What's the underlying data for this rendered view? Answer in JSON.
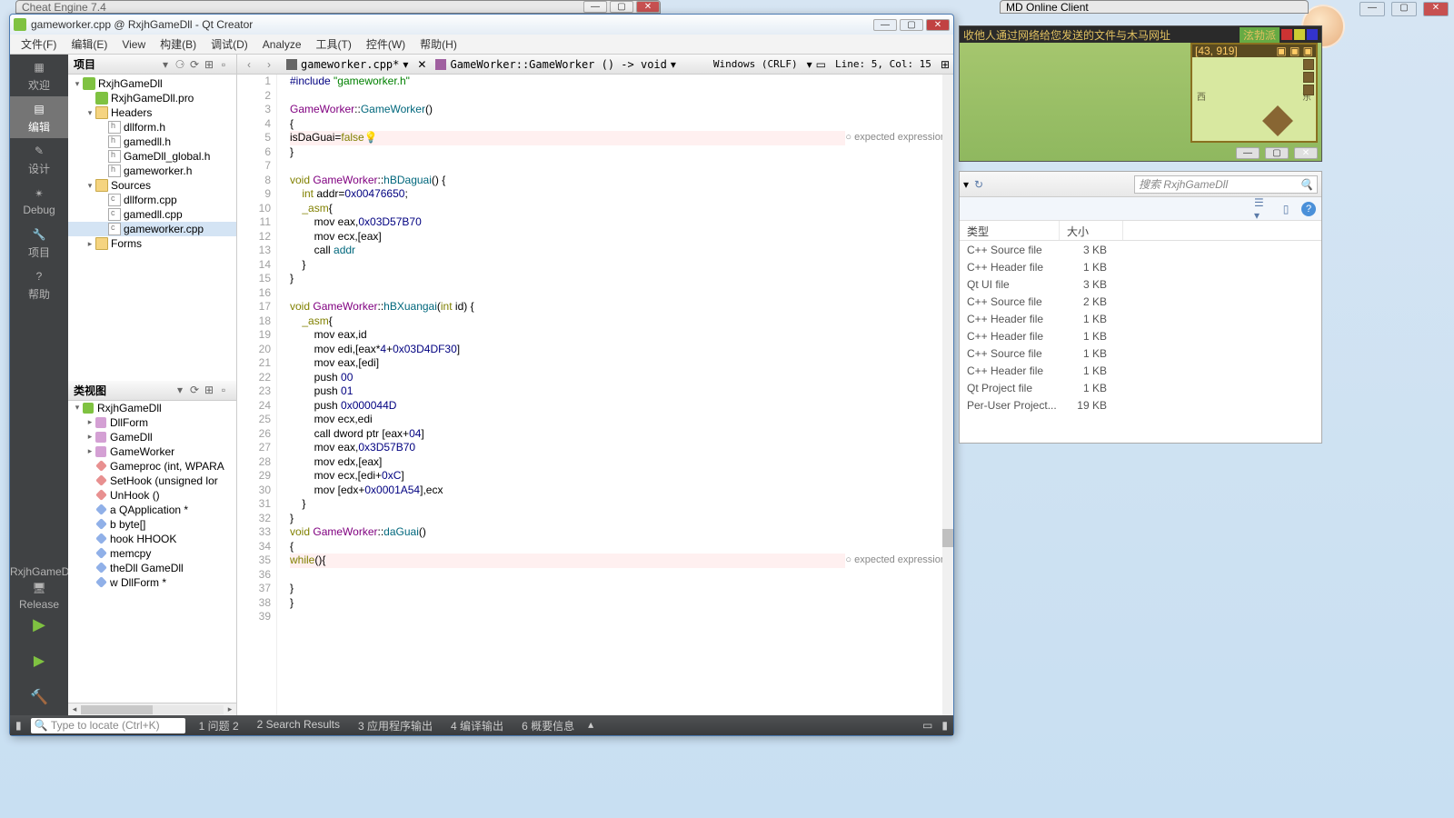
{
  "cheat_engine": {
    "title": "Cheat Engine 7.4"
  },
  "game_client": {
    "title": "MD Online Client"
  },
  "qtc": {
    "title": "gameworker.cpp @ RxjhGameDll - Qt Creator",
    "menu": [
      "文件(F)",
      "编辑(E)",
      "View",
      "构建(B)",
      "调试(D)",
      "Analyze",
      "工具(T)",
      "控件(W)",
      "帮助(H)"
    ],
    "sidebar": {
      "items": [
        "欢迎",
        "编辑",
        "设计",
        "Debug",
        "项目",
        "帮助"
      ],
      "kit_name": "RxjhGameDll",
      "kit_build": "Release"
    },
    "project_panel_title": "项目",
    "class_panel_title": "类视图",
    "tree": {
      "root": "RxjhGameDll",
      "pro": "RxjhGameDll.pro",
      "headers_label": "Headers",
      "headers": [
        "dllform.h",
        "gamedll.h",
        "GameDll_global.h",
        "gameworker.h"
      ],
      "sources_label": "Sources",
      "sources": [
        "dllform.cpp",
        "gamedll.cpp",
        "gameworker.cpp"
      ],
      "forms_label": "Forms"
    },
    "classes": {
      "root": "RxjhGameDll",
      "items": [
        "DllForm",
        "GameDll",
        "GameWorker",
        "Gameproc (int, WPARA",
        "SetHook (unsigned lor",
        "UnHook ()",
        "a QApplication *",
        "b byte[]",
        "hook HHOOK",
        "memcpy",
        "theDll GameDll",
        "w DllForm *"
      ]
    },
    "editor": {
      "file_crumb": "gameworker.cpp*",
      "symbol_crumb": "GameWorker::GameWorker () -> void",
      "encoding": "Windows (CRLF)",
      "position": "Line: 5, Col: 15",
      "error_text": "expected expression",
      "lines": [
        {
          "n": 1,
          "html": "<span class='pp'>#include</span> <span class='str'>\"gameworker.h\"</span>"
        },
        {
          "n": 2,
          "html": ""
        },
        {
          "n": 3,
          "html": "<span class='type'>GameWorker</span>::<span class='func'>GameWorker</span>()"
        },
        {
          "n": 4,
          "html": "{"
        },
        {
          "n": 5,
          "err": true,
          "html": "isDaGuai=<span class='kw'>false</span><span class='bulb'>💡</span>"
        },
        {
          "n": 6,
          "html": "}"
        },
        {
          "n": 7,
          "html": ""
        },
        {
          "n": 8,
          "html": "<span class='kw'>void</span> <span class='type'>GameWorker</span>::<span class='func'>hBDaguai</span>() {"
        },
        {
          "n": 9,
          "html": "    <span class='kw'>int</span> addr=<span class='num'>0x00476650</span>;"
        },
        {
          "n": 10,
          "html": "    <span class='kw'>_asm</span>{"
        },
        {
          "n": 11,
          "html": "        mov eax,<span class='num'>0x03D57B70</span>"
        },
        {
          "n": 12,
          "html": "        mov ecx,[eax]"
        },
        {
          "n": 13,
          "html": "        call <span class='func'>addr</span>"
        },
        {
          "n": 14,
          "html": "    }"
        },
        {
          "n": 15,
          "html": "}"
        },
        {
          "n": 16,
          "html": ""
        },
        {
          "n": 17,
          "html": "<span class='kw'>void</span> <span class='type'>GameWorker</span>::<span class='func'>hBXuangai</span>(<span class='kw'>int</span> id) {"
        },
        {
          "n": 18,
          "html": "    <span class='kw'>_asm</span>{"
        },
        {
          "n": 19,
          "html": "        mov eax,id"
        },
        {
          "n": 20,
          "html": "        mov edi,[eax*<span class='num'>4</span>+<span class='num'>0x03D4DF30</span>]"
        },
        {
          "n": 21,
          "html": "        mov eax,[edi]"
        },
        {
          "n": 22,
          "html": "        push <span class='num'>00</span>"
        },
        {
          "n": 23,
          "html": "        push <span class='num'>01</span>"
        },
        {
          "n": 24,
          "html": "        push <span class='num'>0x000044D</span>"
        },
        {
          "n": 25,
          "html": "        mov ecx,edi"
        },
        {
          "n": 26,
          "html": "        call dword ptr [eax+<span class='num'>04</span>]"
        },
        {
          "n": 27,
          "html": "        mov eax,<span class='num'>0x3D57B70</span>"
        },
        {
          "n": 28,
          "html": "        mov edx,[eax]"
        },
        {
          "n": 29,
          "html": "        mov ecx,[edi+<span class='num'>0xC</span>]"
        },
        {
          "n": 30,
          "html": "        mov [edx+<span class='num'>0x0001A54</span>],ecx"
        },
        {
          "n": 31,
          "html": "    }"
        },
        {
          "n": 32,
          "html": "}"
        },
        {
          "n": 33,
          "html": "<span class='kw'>void</span> <span class='type'>GameWorker</span>::<span class='func'>daGuai</span>()"
        },
        {
          "n": 34,
          "html": "{"
        },
        {
          "n": 35,
          "err": true,
          "html": "<span class='kw'>while</span>(){"
        },
        {
          "n": 36,
          "html": ""
        },
        {
          "n": 37,
          "html": "}"
        },
        {
          "n": 38,
          "html": "}"
        },
        {
          "n": 39,
          "html": ""
        }
      ]
    },
    "status": {
      "locator_placeholder": "Type to locate (Ctrl+K)",
      "panels": [
        "1  问题 2",
        "2  Search Results",
        "3  应用程序输出",
        "4  编译输出",
        "6  概要信息"
      ]
    }
  },
  "game": {
    "topbar": "收他人通过网络给您发送的文件与木马网址",
    "faction": "泫勃派",
    "coords": "[43, 919]"
  },
  "explorer": {
    "search_placeholder": "搜索 RxjhGameDll",
    "col_type": "类型",
    "col_size": "大小",
    "rows": [
      {
        "type": "C++ Source file",
        "size": "3 KB"
      },
      {
        "type": "C++ Header file",
        "size": "1 KB"
      },
      {
        "type": "Qt UI file",
        "size": "3 KB"
      },
      {
        "type": "C++ Source file",
        "size": "2 KB"
      },
      {
        "type": "C++ Header file",
        "size": "1 KB"
      },
      {
        "type": "C++ Header file",
        "size": "1 KB"
      },
      {
        "type": "C++ Source file",
        "size": "1 KB"
      },
      {
        "type": "C++ Header file",
        "size": "1 KB"
      },
      {
        "type": "Qt Project file",
        "size": "1 KB"
      },
      {
        "type": "Per-User Project...",
        "size": "19 KB"
      }
    ]
  }
}
